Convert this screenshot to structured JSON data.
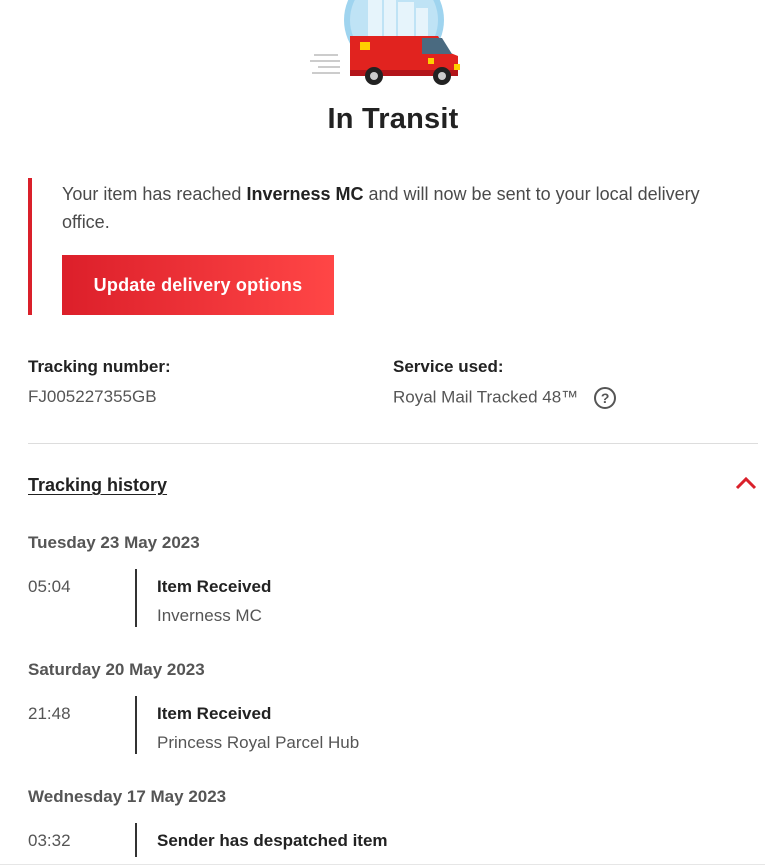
{
  "header": {
    "illustration": "red-delivery-van-icon",
    "status_title": "In Transit"
  },
  "notice": {
    "text_before": "Your item has reached ",
    "location": "Inverness MC",
    "text_after": " and will now be sent to your local delivery office.",
    "button_label": "Update delivery options"
  },
  "tracking": {
    "number_label": "Tracking number:",
    "number_value": "FJ005227355GB",
    "service_label": "Service used:",
    "service_value": "Royal Mail Tracked 48™",
    "help_icon": "?"
  },
  "history": {
    "title": "Tracking history",
    "days": [
      {
        "date": "Tuesday 23 May 2023",
        "events": [
          {
            "time": "05:04",
            "title": "Item Received",
            "location": "Inverness MC"
          }
        ]
      },
      {
        "date": "Saturday 20 May 2023",
        "events": [
          {
            "time": "21:48",
            "title": "Item Received",
            "location": "Princess Royal Parcel Hub"
          }
        ]
      },
      {
        "date": "Wednesday 17 May 2023",
        "events": [
          {
            "time": "03:32",
            "title": "Sender has despatched item",
            "location": ""
          }
        ]
      }
    ]
  },
  "colors": {
    "brand_red": "#da202a",
    "button_gradient_end": "#ff4646",
    "text_dark": "#222222",
    "text_muted": "#555555"
  }
}
